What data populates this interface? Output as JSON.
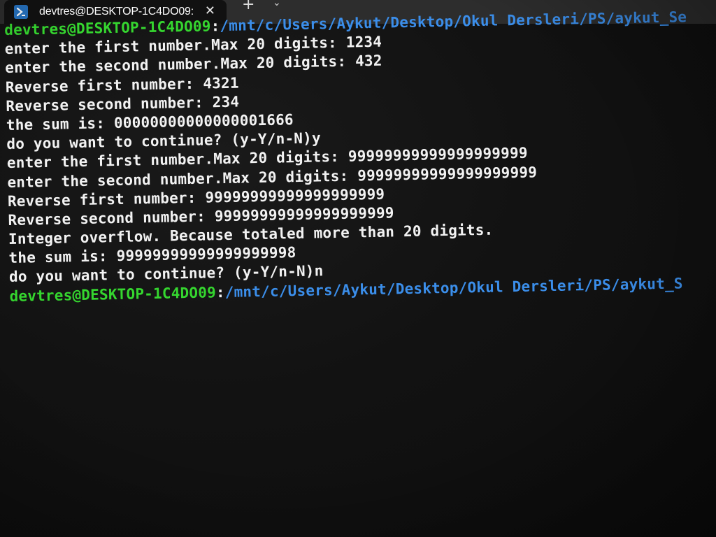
{
  "tab": {
    "icon": "powershell-icon",
    "title": "devtres@DESKTOP-1C4DO09:",
    "close_glyph": "✕",
    "new_tab_glyph": "+",
    "dropdown_glyph": "⌄"
  },
  "prompt": {
    "user": "devtres@DESKTOP-1C4DO09",
    "separator": ":",
    "path": "/mnt/c/Users/Aykut/Desktop/Okul Dersleri/PS/aykut_Se"
  },
  "lines": [
    "enter the first number.Max 20 digits: 1234",
    "enter the second number.Max 20 digits: 432",
    "Reverse first number: 4321",
    "Reverse second number: 234",
    "the sum is: 00000000000000001666",
    "do you want to continue? (y-Y/n-N)y",
    "enter the first number.Max 20 digits: 99999999999999999999",
    "enter the second number.Max 20 digits: 99999999999999999999",
    "Reverse first number: 99999999999999999999",
    "Reverse second number: 99999999999999999999",
    "Integer overflow. Because totaled more than 20 digits.",
    "the sum is: 99999999999999999998",
    "do you want to continue? (y-Y/n-N)n"
  ],
  "prompt_end": {
    "user": "devtres@DESKTOP-1C4DO09",
    "separator": ":",
    "path": "/mnt/c/Users/Aykut/Desktop/Okul Dersleri/PS/aykut_S"
  },
  "colors": {
    "user": "#35d62f",
    "path": "#3b8eea",
    "text": "#f2f2f2",
    "background": "#121212"
  }
}
